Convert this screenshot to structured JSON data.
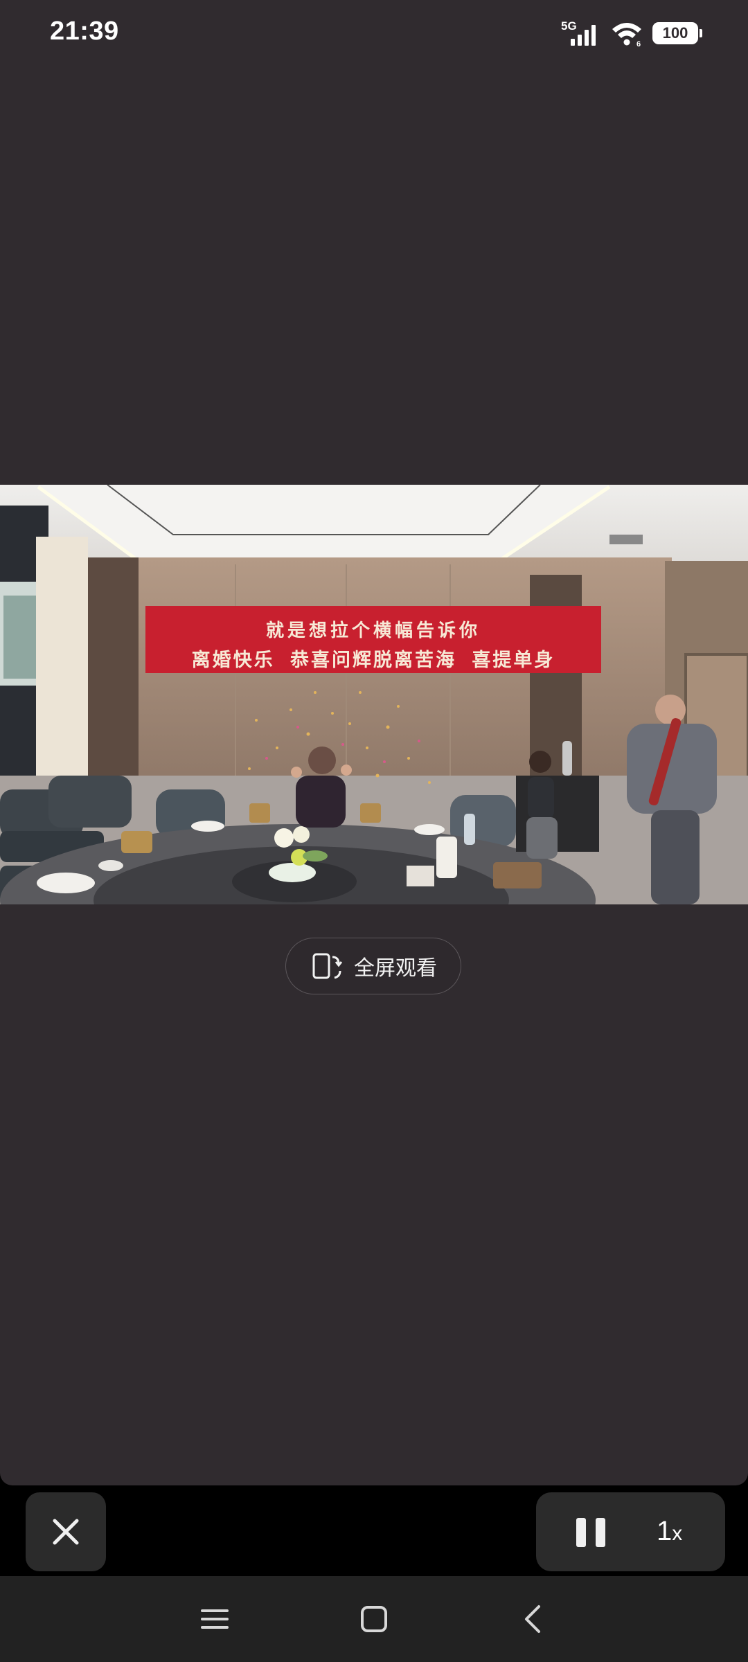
{
  "status_bar": {
    "time": "21:39",
    "network": "5G",
    "battery": "100",
    "icons": [
      "signal-icon",
      "wifi-icon",
      "battery-icon"
    ]
  },
  "video": {
    "banner": {
      "line1": "就是想拉个横幅告诉你",
      "line2": "离婚快乐 恭喜问辉脱离苦海 喜提单身"
    }
  },
  "fullscreen_button": {
    "label": "全屏观看",
    "icon": "rotate-screen-icon"
  },
  "player_controls": {
    "close_icon": "close-icon",
    "pause_icon": "pause-icon",
    "speed": "1",
    "speed_suffix": "x"
  },
  "nav_bar": {
    "icons": [
      "menu-icon",
      "home-icon",
      "back-icon"
    ]
  },
  "colors": {
    "background": "#302b2f",
    "control_bg": "#2b2b2b",
    "banner_red": "#c8202f"
  }
}
